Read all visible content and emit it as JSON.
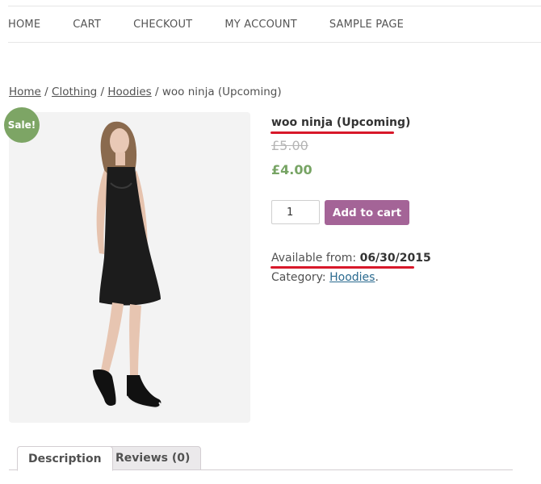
{
  "nav": {
    "items": [
      "HOME",
      "CART",
      "CHECKOUT",
      "MY ACCOUNT",
      "SAMPLE PAGE"
    ]
  },
  "breadcrumb": {
    "home": "Home",
    "sep": "/",
    "clothing": "Clothing",
    "hoodies": "Hoodies",
    "current": "woo ninja (Upcoming)"
  },
  "product": {
    "sale_badge": "Sale!",
    "title": "woo ninja (Upcoming)",
    "regular_price": "£5.00",
    "sale_price": "£4.00",
    "quantity": "1",
    "add_to_cart": "Add to cart",
    "available_label": "Available from:",
    "available_date": "06/30/2015",
    "category_label": "Category:",
    "category_link": "Hoodies",
    "category_end": "."
  },
  "tabs": {
    "description": "Description",
    "reviews": "Reviews (0)"
  },
  "colors": {
    "accent_purple": "#a46497",
    "sale_green": "#77a464",
    "highlight_red": "#d8182a"
  }
}
